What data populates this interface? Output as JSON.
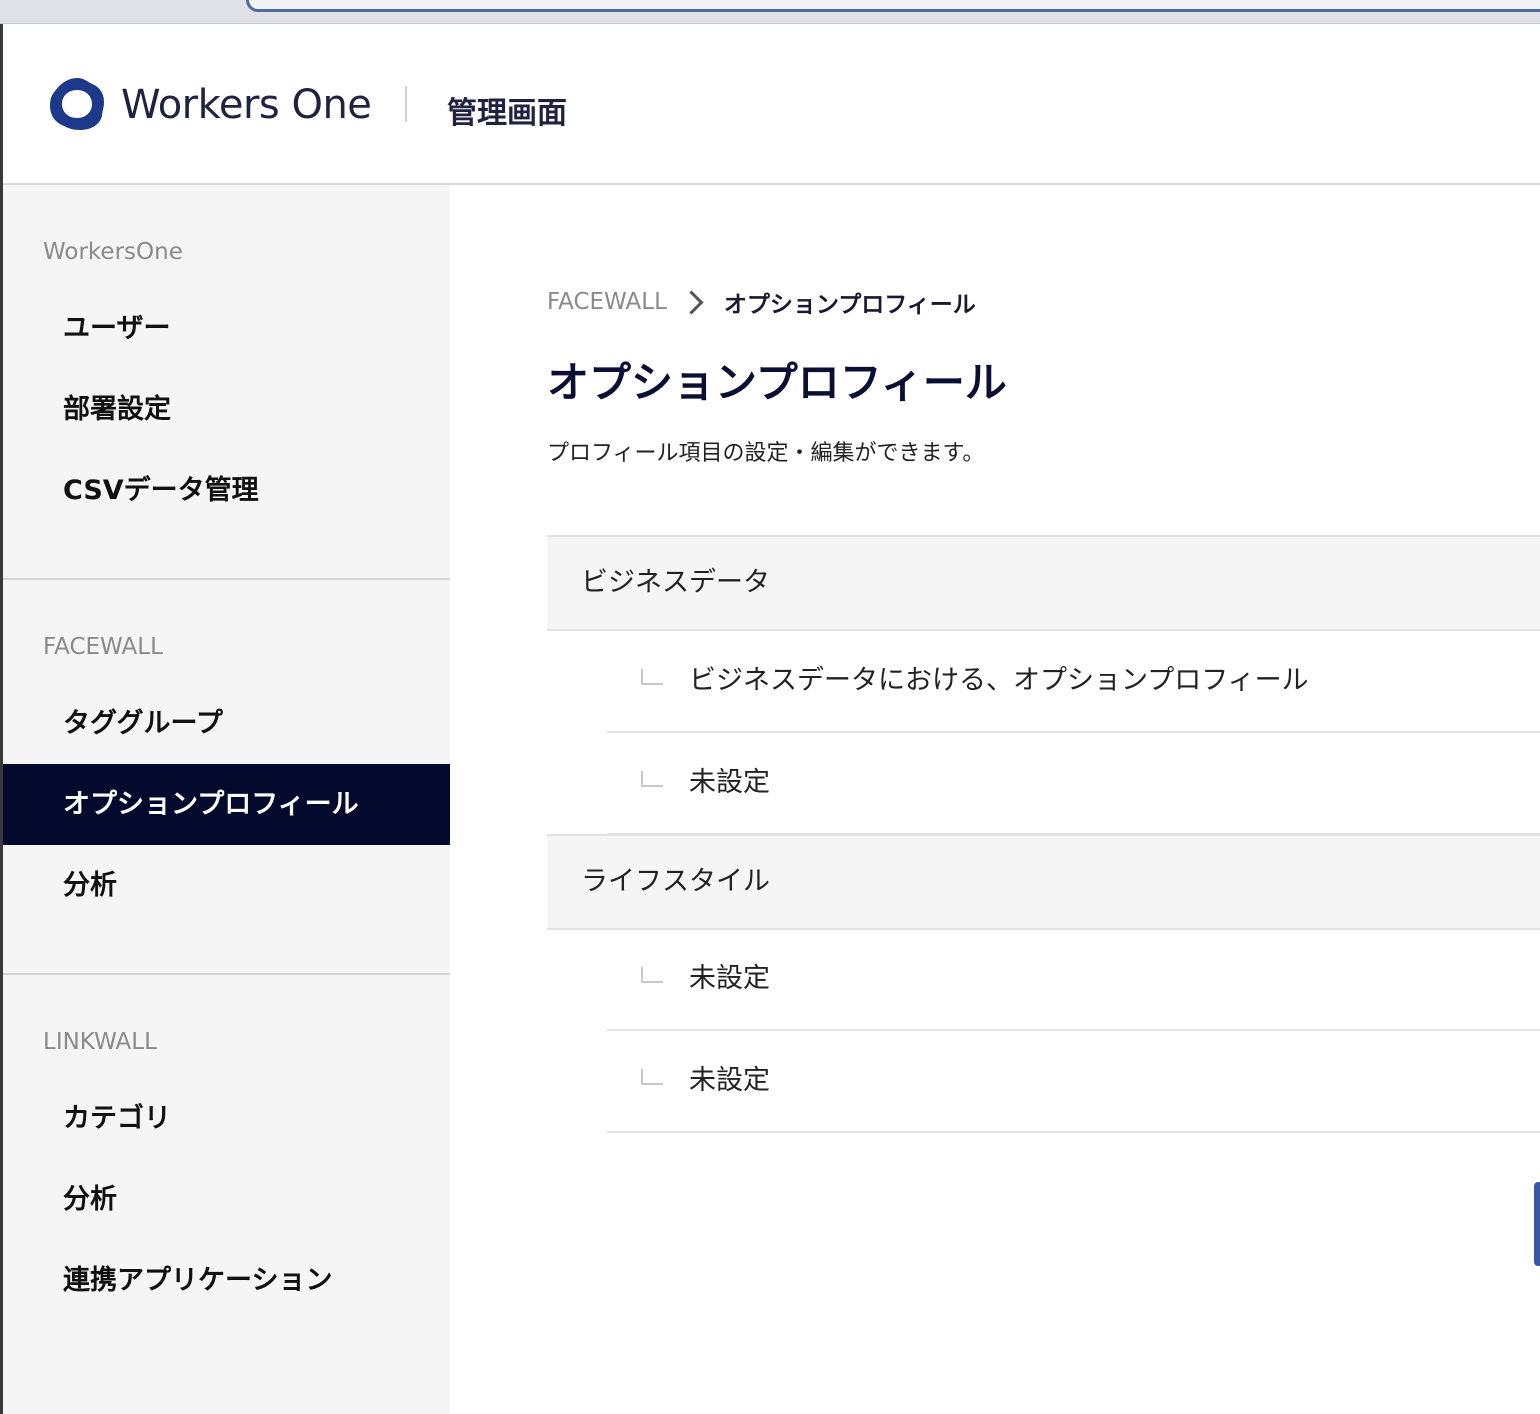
{
  "header": {
    "brand": "Workers One",
    "subtitle": "管理画面"
  },
  "sidebar": {
    "sections": [
      {
        "heading": "WorkersOne",
        "items": [
          {
            "label": "ユーザー"
          },
          {
            "label": "部署設定"
          },
          {
            "label": "CSVデータ管理"
          }
        ]
      },
      {
        "heading": "FACEWALL",
        "items": [
          {
            "label": "タググループ"
          },
          {
            "label": "オプションプロフィール",
            "active": true
          },
          {
            "label": "分析"
          }
        ]
      },
      {
        "heading": "LINKWALL",
        "items": [
          {
            "label": "カテゴリ"
          },
          {
            "label": "分析"
          },
          {
            "label": "連携アプリケーション"
          }
        ]
      }
    ]
  },
  "main": {
    "breadcrumb": {
      "parent": "FACEWALL",
      "current": "オプションプロフィール"
    },
    "title": "オプションプロフィール",
    "description": "プロフィール項目の設定・編集ができます。",
    "groups": [
      {
        "name": "ビジネスデータ",
        "items": [
          {
            "label": "ビジネスデータにおける、オプションプロフィール"
          },
          {
            "label": "未設定"
          }
        ]
      },
      {
        "name": "ライフスタイル",
        "items": [
          {
            "label": "未設定"
          },
          {
            "label": "未設定"
          }
        ]
      }
    ]
  },
  "colors": {
    "brand_navy": "#040a2d",
    "logo_blue": "#1d3a8a",
    "accent": "#3b56a6"
  }
}
